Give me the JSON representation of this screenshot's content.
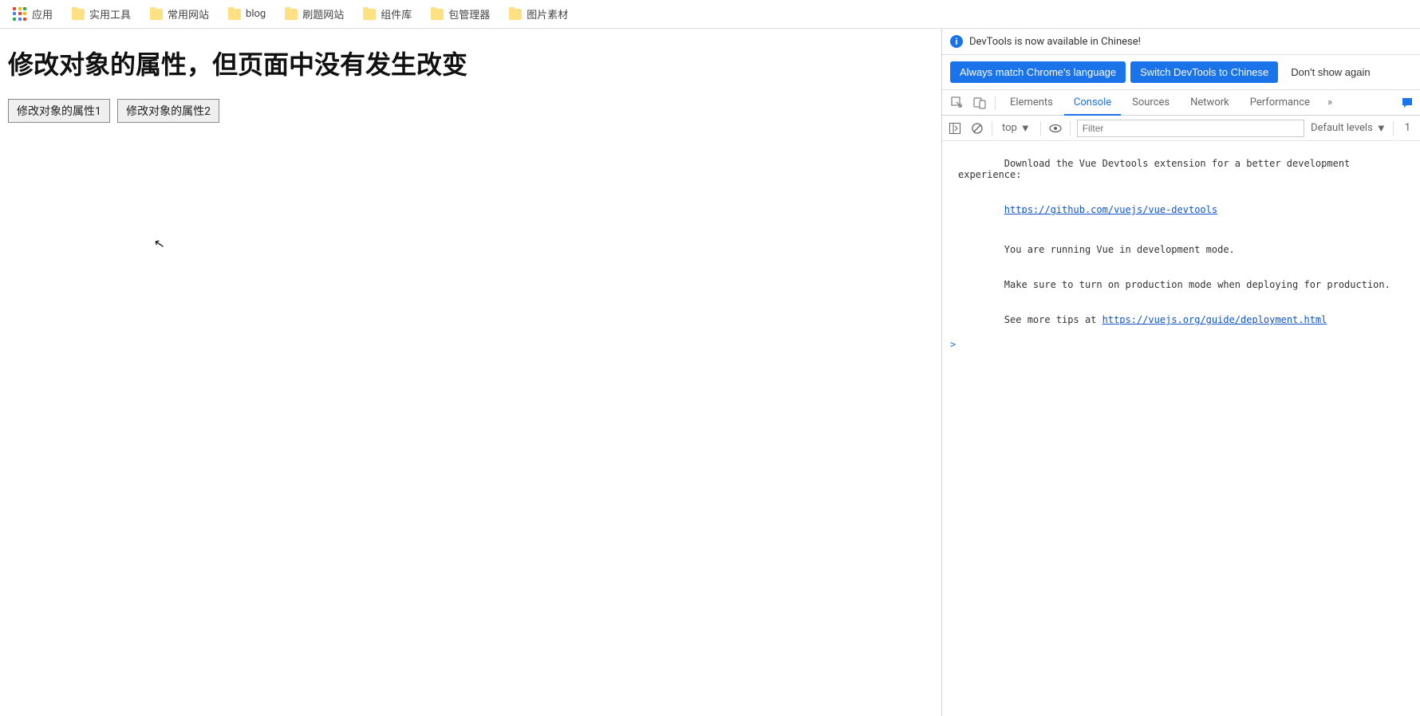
{
  "bookmarks": {
    "apps_label": "应用",
    "folders": [
      {
        "label": "实用工具"
      },
      {
        "label": "常用网站"
      },
      {
        "label": "blog"
      },
      {
        "label": "刷题网站"
      },
      {
        "label": "组件库"
      },
      {
        "label": "包管理器"
      },
      {
        "label": "图片素材"
      }
    ]
  },
  "page": {
    "title": "修改对象的属性，但页面中没有发生改变",
    "button1": "修改对象的属性1",
    "button2": "修改对象的属性2"
  },
  "devtools": {
    "banner_text": "DevTools is now available in Chinese!",
    "btn_always": "Always match Chrome's language",
    "btn_switch": "Switch DevTools to Chinese",
    "btn_dont": "Don't show again",
    "tabs": {
      "elements": "Elements",
      "console": "Console",
      "sources": "Sources",
      "network": "Network",
      "performance": "Performance"
    },
    "toolbar": {
      "context": "top",
      "filter_placeholder": "Filter",
      "levels": "Default levels",
      "issue_count": "1"
    },
    "console": {
      "line1": "Download the Vue Devtools extension for a better development experience:",
      "link1": "https://github.com/vuejs/vue-devtools",
      "line2": "You are running Vue in development mode.",
      "line3": "Make sure to turn on production mode when deploying for production.",
      "line4_prefix": "See more tips at ",
      "link2": "https://vuejs.org/guide/deployment.html",
      "prompt": ">"
    }
  }
}
